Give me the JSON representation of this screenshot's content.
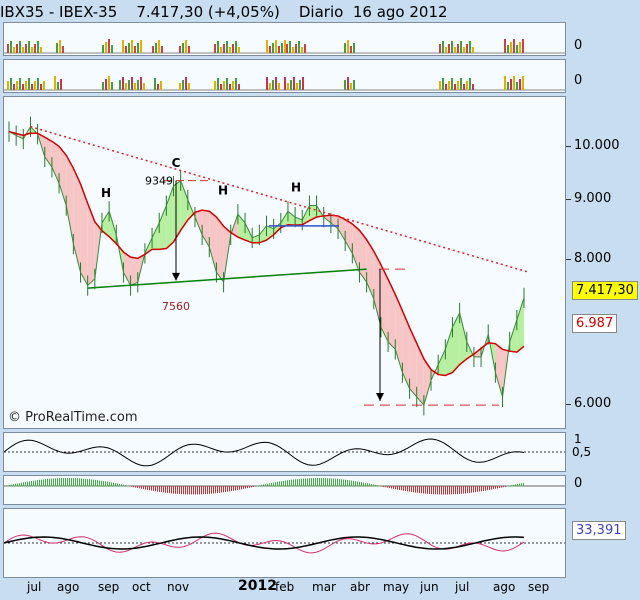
{
  "header": {
    "title": "IBX35 - IBEX-35    7.417,30 (+4,05%)    Diario  16 ago 2012"
  },
  "indicators": {
    "panel1_value": "0",
    "panel2_value": "0",
    "osc_low": "0,5",
    "osc_high": "1",
    "hist_value": "0",
    "last_value": "33,391"
  },
  "watermark": "© ProRealTime.com",
  "colors": {
    "price_current": "#ffff00",
    "ma_box": "#ffffff",
    "ma_text": "#d00000",
    "ma_line": "#d00000",
    "trend_dotted": "#e02020",
    "support_line": "#008000"
  },
  "chart_data": {
    "type": "line",
    "title": "IBX35 - IBEX-35",
    "y_ticks": [
      "10.000",
      "9.000",
      "8.000",
      "7.000",
      "6.000"
    ],
    "ylim": [
      5850,
      10600
    ],
    "x_ticks": [
      "jul",
      "ago",
      "sep",
      "oct",
      "nov",
      "2012",
      "feb",
      "mar",
      "abr",
      "may",
      "jun",
      "jul",
      "ago",
      "sep"
    ],
    "current_price": "7.417,30",
    "moving_average": "6.987",
    "series": [
      {
        "values": [
          10300,
          10220,
          10150,
          10400,
          10250,
          9800,
          9600,
          9300,
          8900,
          8250,
          7800,
          7600,
          7700,
          8600,
          8800,
          8400,
          7800,
          7600,
          7650,
          8100,
          8350,
          8600,
          8900,
          9250,
          9349,
          9000,
          8700,
          8400,
          8200,
          7800,
          7650,
          8400,
          8750,
          8600,
          8350,
          8400,
          8550,
          8500,
          8600,
          8800,
          8700,
          8650,
          8900,
          8900,
          8700,
          8600,
          8500,
          8300,
          8100,
          7800,
          7650,
          7400,
          7000,
          6800,
          6700,
          6400,
          6200,
          6100,
          6000,
          6300,
          6500,
          6700,
          7000,
          7200,
          6800,
          6600,
          6600,
          6900,
          6400,
          6100,
          6800,
          7100,
          7417
        ]
      }
    ],
    "annotations": [
      "C",
      "H",
      "H",
      "H",
      "9349",
      "7560"
    ]
  }
}
